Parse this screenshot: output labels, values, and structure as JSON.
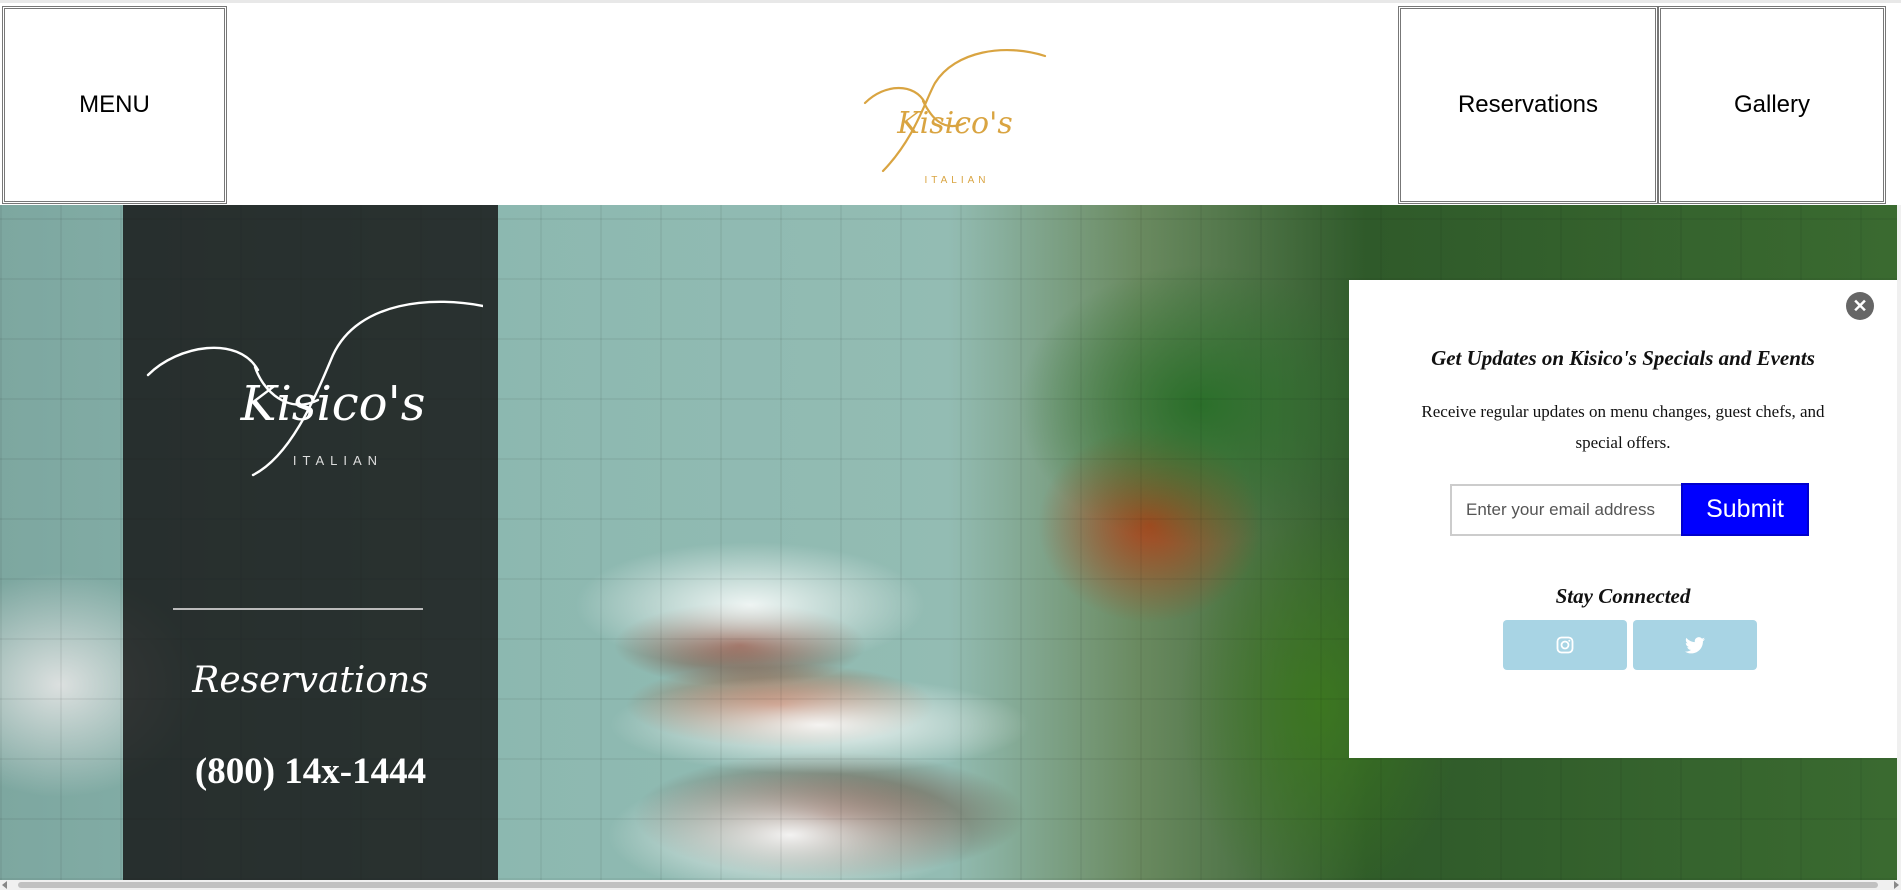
{
  "header": {
    "menu_label": "MENU",
    "reservations_label": "Reservations",
    "gallery_label": "Gallery",
    "logo_text": "Kisico's",
    "logo_sub": "ITALIAN",
    "logo_color": "#d9a441"
  },
  "side_panel": {
    "logo_text": "Kisico's",
    "logo_sub": "ITALIAN",
    "reservations_label": "Reservations",
    "phone": "(800) 14x-1444"
  },
  "popup": {
    "close_icon": "close-icon",
    "title": "Get Updates on Kisico's Specials and Events",
    "description": "Receive regular updates on menu changes, guest chefs, and special offers.",
    "email_placeholder": "Enter your email address",
    "submit_label": "Submit",
    "submit_color": "#0000ff",
    "stay_connected": "Stay Connected",
    "social": [
      {
        "icon": "instagram-icon"
      },
      {
        "icon": "twitter-icon"
      }
    ],
    "social_color": "#a8d4e4"
  }
}
